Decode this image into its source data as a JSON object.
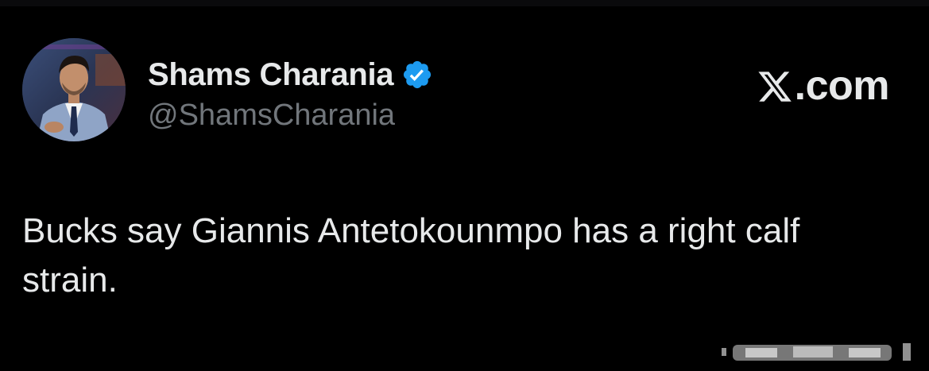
{
  "author": {
    "display_name": "Shams Charania",
    "handle": "@ShamsCharania",
    "verified": true,
    "avatar_icon": "profile-photo"
  },
  "brand": {
    "label": "X.com",
    "suffix": ".com",
    "logo_icon": "x-logo-icon"
  },
  "tweet": {
    "text": "Bucks say Giannis Antetokounmpo has a right calf strain."
  },
  "colors": {
    "background": "#000000",
    "primary_text": "#e7e9ea",
    "secondary_text": "#71767b",
    "verified_badge": "#1d9bf0"
  }
}
